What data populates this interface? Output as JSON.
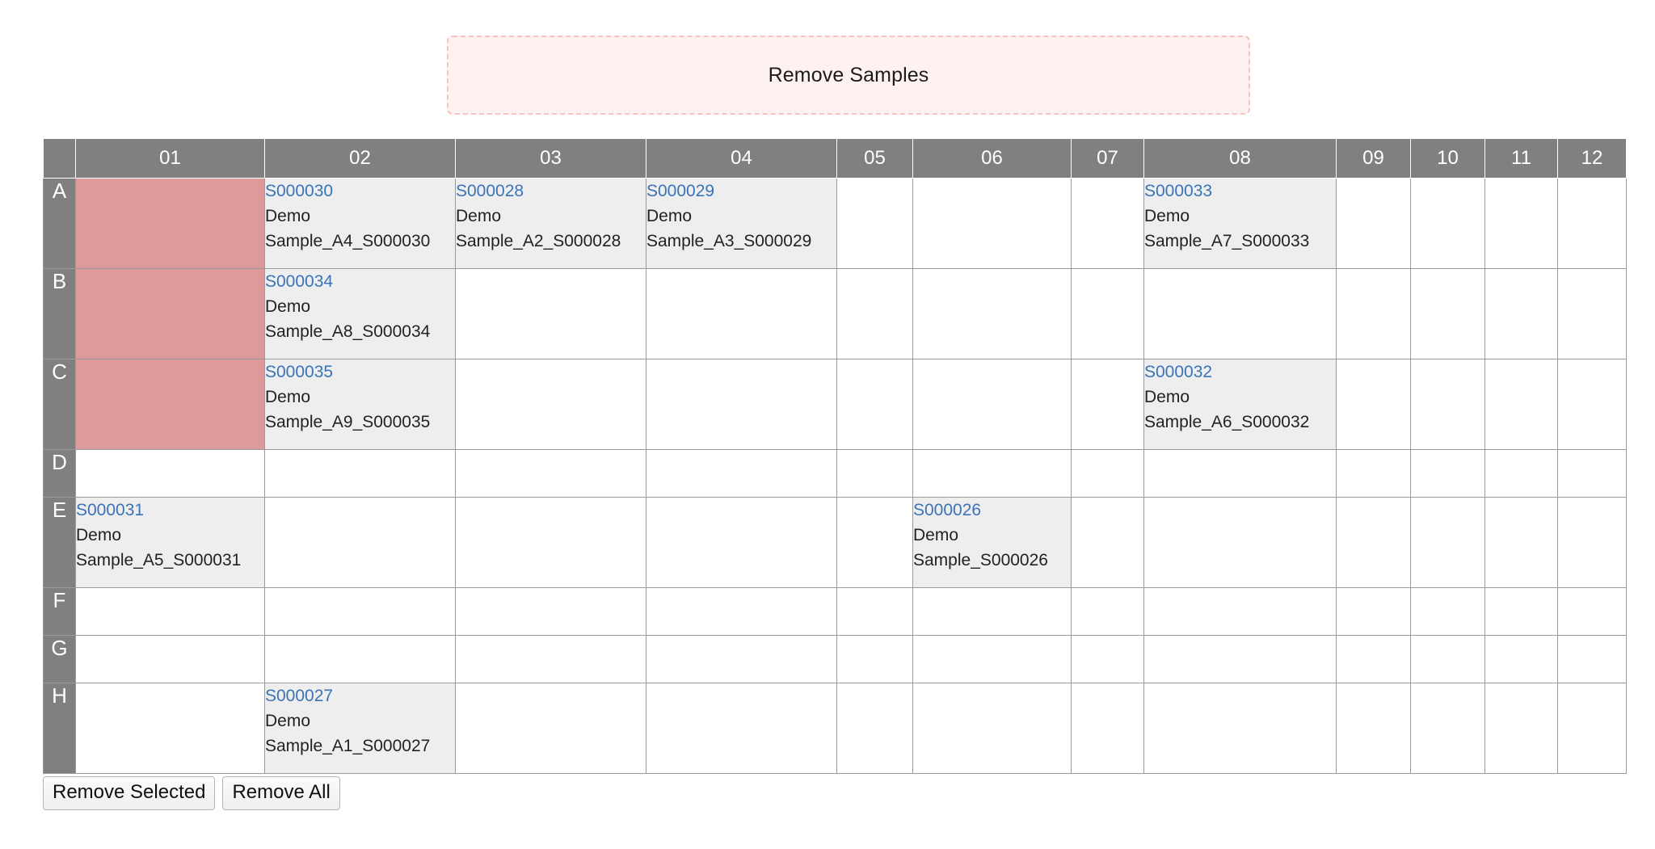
{
  "dropzone": {
    "label": "Remove Samples",
    "background_color": "#fdf2f0",
    "border_color": "#f4c3c3"
  },
  "plate": {
    "corner_label": "",
    "column_headers": [
      "01",
      "02",
      "03",
      "04",
      "05",
      "06",
      "07",
      "08",
      "09",
      "10",
      "11",
      "12"
    ],
    "row_headers": [
      "A",
      "B",
      "C",
      "D",
      "E",
      "F",
      "G",
      "H"
    ],
    "header_background_color": "#808080",
    "header_text_color": "#ffffff",
    "filled_well_color": "#eeeeee",
    "marked_well_color": "#dc9a9a",
    "sample_id_color": "#3b73b9",
    "rows": [
      {
        "label": "A",
        "height": "tall",
        "cells": [
          {
            "state": "marked",
            "id": "",
            "name": ""
          },
          {
            "state": "filled",
            "id": "S000030",
            "name": "Demo Sample_A4_S000030"
          },
          {
            "state": "filled",
            "id": "S000028",
            "name": "Demo Sample_A2_S000028"
          },
          {
            "state": "filled",
            "id": "S000029",
            "name": "Demo Sample_A3_S000029"
          },
          {
            "state": "empty",
            "id": "",
            "name": ""
          },
          {
            "state": "empty",
            "id": "",
            "name": ""
          },
          {
            "state": "empty",
            "id": "",
            "name": ""
          },
          {
            "state": "filled",
            "id": "S000033",
            "name": "Demo Sample_A7_S000033"
          },
          {
            "state": "empty",
            "id": "",
            "name": ""
          },
          {
            "state": "empty",
            "id": "",
            "name": ""
          },
          {
            "state": "empty",
            "id": "",
            "name": ""
          },
          {
            "state": "empty",
            "id": "",
            "name": ""
          }
        ]
      },
      {
        "label": "B",
        "height": "tall",
        "cells": [
          {
            "state": "marked",
            "id": "",
            "name": ""
          },
          {
            "state": "filled",
            "id": "S000034",
            "name": "Demo Sample_A8_S000034"
          },
          {
            "state": "empty",
            "id": "",
            "name": ""
          },
          {
            "state": "empty",
            "id": "",
            "name": ""
          },
          {
            "state": "empty",
            "id": "",
            "name": ""
          },
          {
            "state": "empty",
            "id": "",
            "name": ""
          },
          {
            "state": "empty",
            "id": "",
            "name": ""
          },
          {
            "state": "empty",
            "id": "",
            "name": ""
          },
          {
            "state": "empty",
            "id": "",
            "name": ""
          },
          {
            "state": "empty",
            "id": "",
            "name": ""
          },
          {
            "state": "empty",
            "id": "",
            "name": ""
          },
          {
            "state": "empty",
            "id": "",
            "name": ""
          }
        ]
      },
      {
        "label": "C",
        "height": "tall",
        "cells": [
          {
            "state": "marked",
            "id": "",
            "name": ""
          },
          {
            "state": "filled",
            "id": "S000035",
            "name": "Demo Sample_A9_S000035"
          },
          {
            "state": "empty",
            "id": "",
            "name": ""
          },
          {
            "state": "empty",
            "id": "",
            "name": ""
          },
          {
            "state": "empty",
            "id": "",
            "name": ""
          },
          {
            "state": "empty",
            "id": "",
            "name": ""
          },
          {
            "state": "empty",
            "id": "",
            "name": ""
          },
          {
            "state": "filled",
            "id": "S000032",
            "name": "Demo Sample_A6_S000032"
          },
          {
            "state": "empty",
            "id": "",
            "name": ""
          },
          {
            "state": "empty",
            "id": "",
            "name": ""
          },
          {
            "state": "empty",
            "id": "",
            "name": ""
          },
          {
            "state": "empty",
            "id": "",
            "name": ""
          }
        ]
      },
      {
        "label": "D",
        "height": "short",
        "cells": [
          {
            "state": "empty",
            "id": "",
            "name": ""
          },
          {
            "state": "empty",
            "id": "",
            "name": ""
          },
          {
            "state": "empty",
            "id": "",
            "name": ""
          },
          {
            "state": "empty",
            "id": "",
            "name": ""
          },
          {
            "state": "empty",
            "id": "",
            "name": ""
          },
          {
            "state": "empty",
            "id": "",
            "name": ""
          },
          {
            "state": "empty",
            "id": "",
            "name": ""
          },
          {
            "state": "empty",
            "id": "",
            "name": ""
          },
          {
            "state": "empty",
            "id": "",
            "name": ""
          },
          {
            "state": "empty",
            "id": "",
            "name": ""
          },
          {
            "state": "empty",
            "id": "",
            "name": ""
          },
          {
            "state": "empty",
            "id": "",
            "name": ""
          }
        ]
      },
      {
        "label": "E",
        "height": "tall",
        "cells": [
          {
            "state": "filled",
            "id": "S000031",
            "name": "Demo Sample_A5_S000031"
          },
          {
            "state": "empty",
            "id": "",
            "name": ""
          },
          {
            "state": "empty",
            "id": "",
            "name": ""
          },
          {
            "state": "empty",
            "id": "",
            "name": ""
          },
          {
            "state": "empty",
            "id": "",
            "name": ""
          },
          {
            "state": "filled",
            "id": "S000026",
            "name": "Demo Sample_S000026"
          },
          {
            "state": "empty",
            "id": "",
            "name": ""
          },
          {
            "state": "empty",
            "id": "",
            "name": ""
          },
          {
            "state": "empty",
            "id": "",
            "name": ""
          },
          {
            "state": "empty",
            "id": "",
            "name": ""
          },
          {
            "state": "empty",
            "id": "",
            "name": ""
          },
          {
            "state": "empty",
            "id": "",
            "name": ""
          }
        ]
      },
      {
        "label": "F",
        "height": "short",
        "cells": [
          {
            "state": "empty",
            "id": "",
            "name": ""
          },
          {
            "state": "empty",
            "id": "",
            "name": ""
          },
          {
            "state": "empty",
            "id": "",
            "name": ""
          },
          {
            "state": "empty",
            "id": "",
            "name": ""
          },
          {
            "state": "empty",
            "id": "",
            "name": ""
          },
          {
            "state": "empty",
            "id": "",
            "name": ""
          },
          {
            "state": "empty",
            "id": "",
            "name": ""
          },
          {
            "state": "empty",
            "id": "",
            "name": ""
          },
          {
            "state": "empty",
            "id": "",
            "name": ""
          },
          {
            "state": "empty",
            "id": "",
            "name": ""
          },
          {
            "state": "empty",
            "id": "",
            "name": ""
          },
          {
            "state": "empty",
            "id": "",
            "name": ""
          }
        ]
      },
      {
        "label": "G",
        "height": "short",
        "cells": [
          {
            "state": "empty",
            "id": "",
            "name": ""
          },
          {
            "state": "empty",
            "id": "",
            "name": ""
          },
          {
            "state": "empty",
            "id": "",
            "name": ""
          },
          {
            "state": "empty",
            "id": "",
            "name": ""
          },
          {
            "state": "empty",
            "id": "",
            "name": ""
          },
          {
            "state": "empty",
            "id": "",
            "name": ""
          },
          {
            "state": "empty",
            "id": "",
            "name": ""
          },
          {
            "state": "empty",
            "id": "",
            "name": ""
          },
          {
            "state": "empty",
            "id": "",
            "name": ""
          },
          {
            "state": "empty",
            "id": "",
            "name": ""
          },
          {
            "state": "empty",
            "id": "",
            "name": ""
          },
          {
            "state": "empty",
            "id": "",
            "name": ""
          }
        ]
      },
      {
        "label": "H",
        "height": "tall",
        "cells": [
          {
            "state": "empty",
            "id": "",
            "name": ""
          },
          {
            "state": "filled",
            "id": "S000027",
            "name": "Demo Sample_A1_S000027"
          },
          {
            "state": "empty",
            "id": "",
            "name": ""
          },
          {
            "state": "empty",
            "id": "",
            "name": ""
          },
          {
            "state": "empty",
            "id": "",
            "name": ""
          },
          {
            "state": "empty",
            "id": "",
            "name": ""
          },
          {
            "state": "empty",
            "id": "",
            "name": ""
          },
          {
            "state": "empty",
            "id": "",
            "name": ""
          },
          {
            "state": "empty",
            "id": "",
            "name": ""
          },
          {
            "state": "empty",
            "id": "",
            "name": ""
          },
          {
            "state": "empty",
            "id": "",
            "name": ""
          },
          {
            "state": "empty",
            "id": "",
            "name": ""
          }
        ]
      }
    ]
  },
  "buttons": {
    "remove_selected": "Remove Selected",
    "remove_all": "Remove All"
  }
}
